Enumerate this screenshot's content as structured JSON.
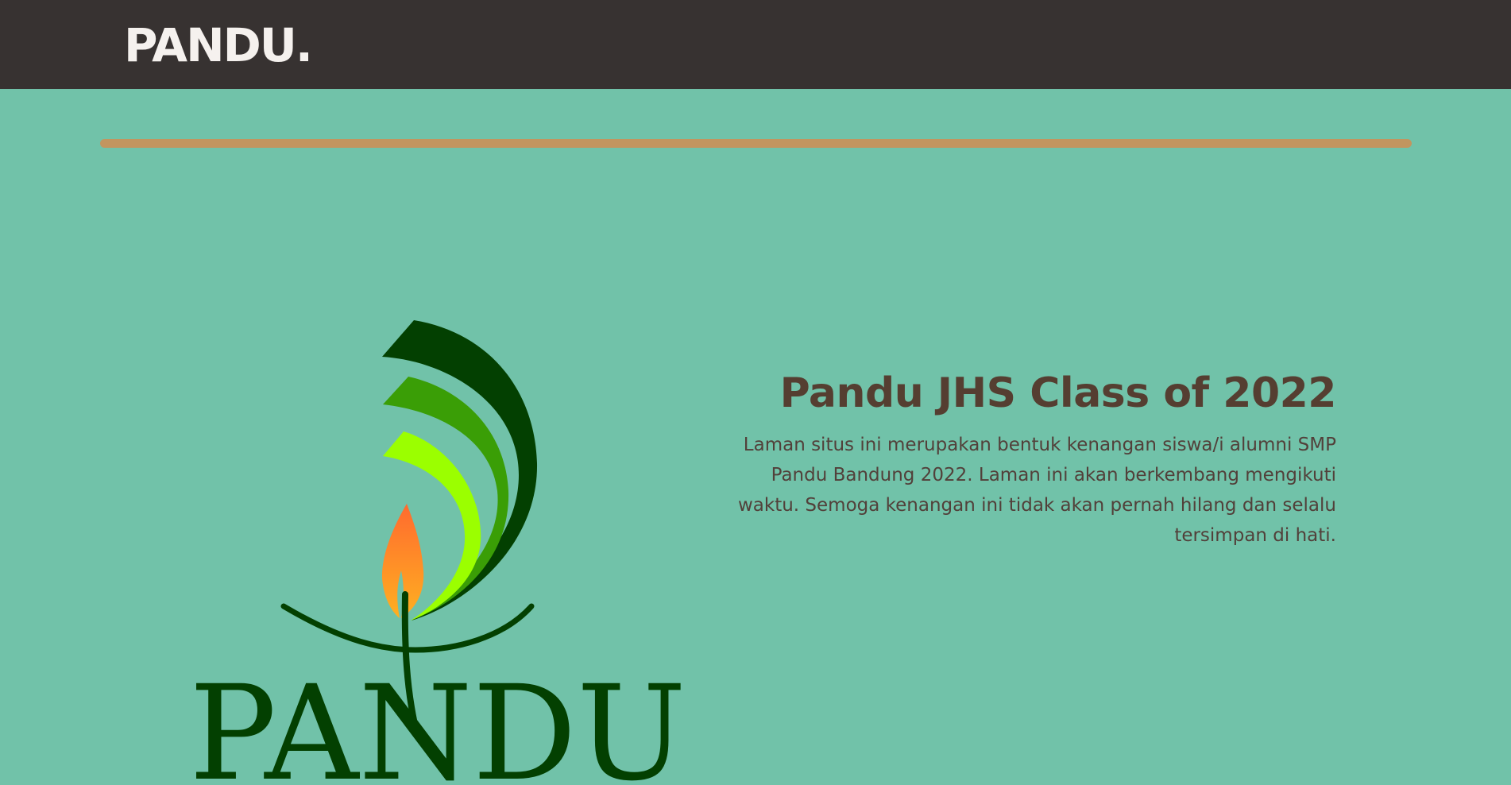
{
  "navbar": {
    "brand": "PANDU."
  },
  "hero": {
    "title": "Pandu JHS Class of 2022",
    "description": "Laman situs ini merupakan bentuk kenangan siswa/i alumni SMP Pandu Bandung 2022. Laman ini akan berkembang mengikuti waktu. Semoga kenangan ini tidak akan pernah hilang dan selalu tersimpan di hati."
  },
  "logo": {
    "wordmark": "PANDU",
    "icon": "pandu-flame-leaves-logo"
  },
  "colors": {
    "navbar": "#373231",
    "background": "#71c2a9",
    "divider": "#c2955f",
    "title": "#553e31",
    "logo_dark_green": "#034001",
    "logo_mid_green": "#3a9e06",
    "logo_lime": "#9bff00",
    "flame_orange": "#ff7b2e"
  }
}
